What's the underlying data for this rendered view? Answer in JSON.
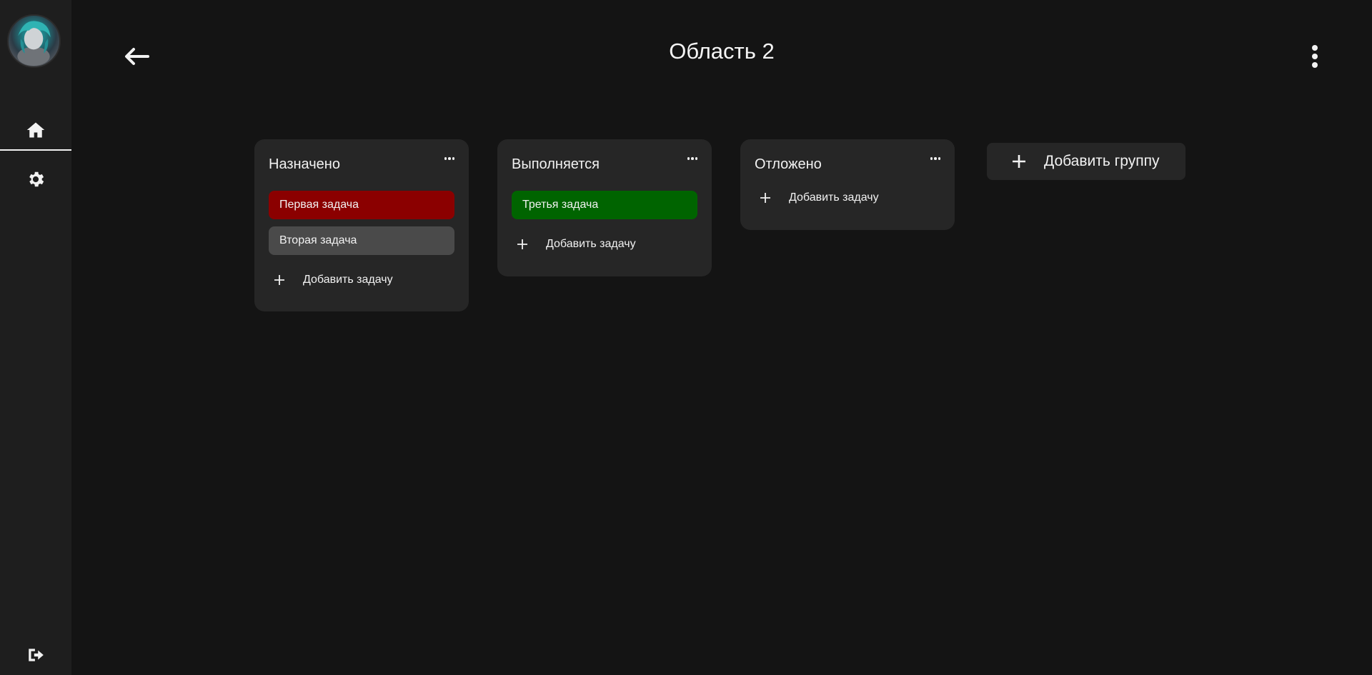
{
  "sidebar": {
    "avatar": "user-avatar",
    "items": [
      {
        "name": "home",
        "icon": "home-icon",
        "active": true
      },
      {
        "name": "settings",
        "icon": "gear-icon",
        "active": false
      }
    ],
    "logout_icon": "logout-icon"
  },
  "header": {
    "title": "Область 2",
    "back_icon": "arrow-left-icon",
    "menu_icon": "more-vertical-icon"
  },
  "groups": [
    {
      "title": "Назначено",
      "tasks": [
        {
          "label": "Первая задача",
          "color": "#8b0000"
        },
        {
          "label": "Вторая задача",
          "color": "#4a4a4a"
        }
      ],
      "add_task_label": "Добавить задачу"
    },
    {
      "title": "Выполняется",
      "tasks": [
        {
          "label": "Третья задача",
          "color": "#006400"
        }
      ],
      "add_task_label": "Добавить задачу"
    },
    {
      "title": "Отложено",
      "tasks": [],
      "add_task_label": "Добавить задачу"
    }
  ],
  "add_group_label": "Добавить группу",
  "colors": {
    "background": "#141414",
    "sidebar": "#1e1e1e",
    "card": "#262626",
    "text": "#f2f2f2"
  }
}
